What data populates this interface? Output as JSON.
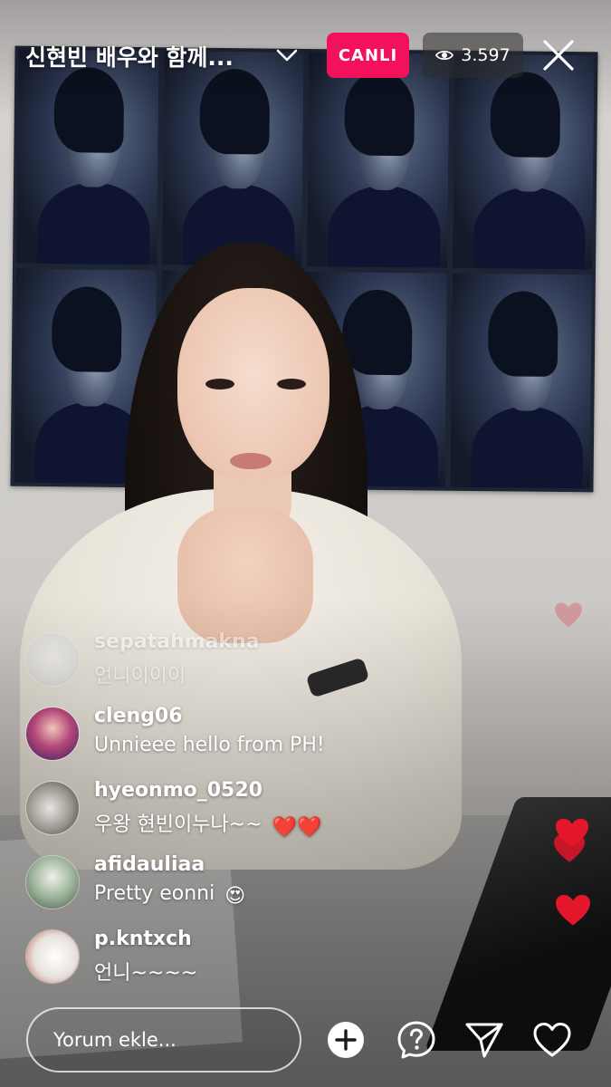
{
  "header": {
    "title": "신현빈 배우와 함께...",
    "live_badge": "CANLI",
    "viewer_count": "3.597"
  },
  "comments": [
    {
      "username": "sepatahmakna",
      "text": "언니이이이",
      "faded": true
    },
    {
      "username": "cleng06",
      "text": "Unnieee hello from  PH!"
    },
    {
      "username": "hyeonmo_0520",
      "text": "우왕 현빈이누나~~",
      "emoji": "❤️❤️"
    },
    {
      "username": "afidauliaa",
      "text": "Pretty eonni",
      "emoji": "😍"
    },
    {
      "username": "p.kntxch",
      "text": "언니~~~~"
    }
  ],
  "bottom_bar": {
    "comment_placeholder": "Yorum ekle..."
  },
  "colors": {
    "live_badge": "#f4115c",
    "heart": "#e3162b"
  },
  "icons": [
    "chevron-down-icon",
    "eye-icon",
    "close-icon",
    "add-circle-icon",
    "question-icon",
    "send-icon",
    "heart-outline-icon",
    "heart-icon"
  ]
}
